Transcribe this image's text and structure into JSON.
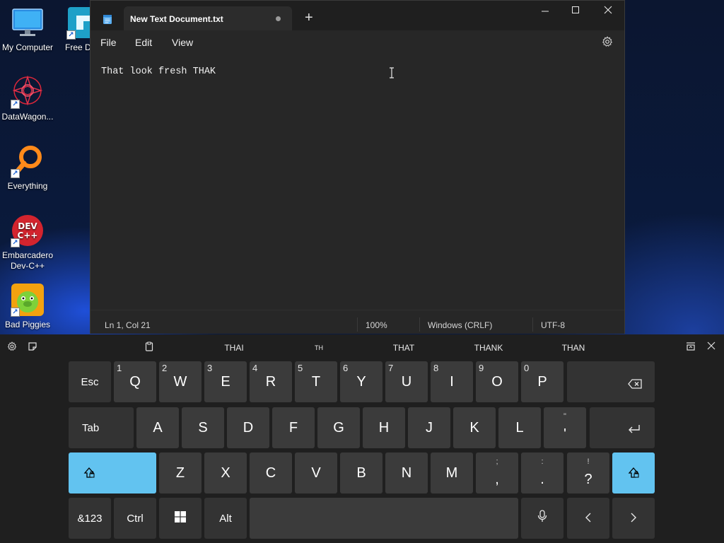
{
  "desktop": {
    "icons": [
      {
        "label": "My Computer"
      },
      {
        "label": "Free Downl..."
      },
      {
        "label": "DataWagon..."
      },
      {
        "label": "Everything"
      },
      {
        "label": "Embarcadero Dev-C++"
      },
      {
        "label": "Bad Piggies"
      }
    ]
  },
  "notepad": {
    "tab_title": "New Text Document.txt",
    "menu": {
      "file": "File",
      "edit": "Edit",
      "view": "View"
    },
    "content": "That look fresh THAK",
    "status": {
      "position": "Ln 1, Col 21",
      "zoom": "100%",
      "line_ending": "Windows (CRLF)",
      "encoding": "UTF-8"
    }
  },
  "keyboard": {
    "suggestions": [
      "THAI",
      "TH",
      "THAT",
      "THANK",
      "THAN"
    ],
    "row1": {
      "esc": "Esc",
      "keys": [
        {
          "num": "1",
          "letter": "Q"
        },
        {
          "num": "2",
          "letter": "W"
        },
        {
          "num": "3",
          "letter": "E"
        },
        {
          "num": "4",
          "letter": "R"
        },
        {
          "num": "5",
          "letter": "T"
        },
        {
          "num": "6",
          "letter": "Y"
        },
        {
          "num": "7",
          "letter": "U"
        },
        {
          "num": "8",
          "letter": "I"
        },
        {
          "num": "9",
          "letter": "O"
        },
        {
          "num": "0",
          "letter": "P"
        }
      ]
    },
    "row2": {
      "tab": "Tab",
      "keys": [
        "A",
        "S",
        "D",
        "F",
        "G",
        "H",
        "J",
        "K",
        "L"
      ],
      "quote_main": "'",
      "quote_alt": "\""
    },
    "row3": {
      "keys": [
        "Z",
        "X",
        "C",
        "V",
        "B",
        "N",
        "M"
      ],
      "comma_main": ",",
      "comma_alt": ";",
      "period_main": ".",
      "period_alt": ":",
      "question_main": "?",
      "question_alt": "!"
    },
    "row4": {
      "sym": "&123",
      "ctrl": "Ctrl",
      "alt": "Alt"
    },
    "accent_color": "#62c3f0"
  }
}
